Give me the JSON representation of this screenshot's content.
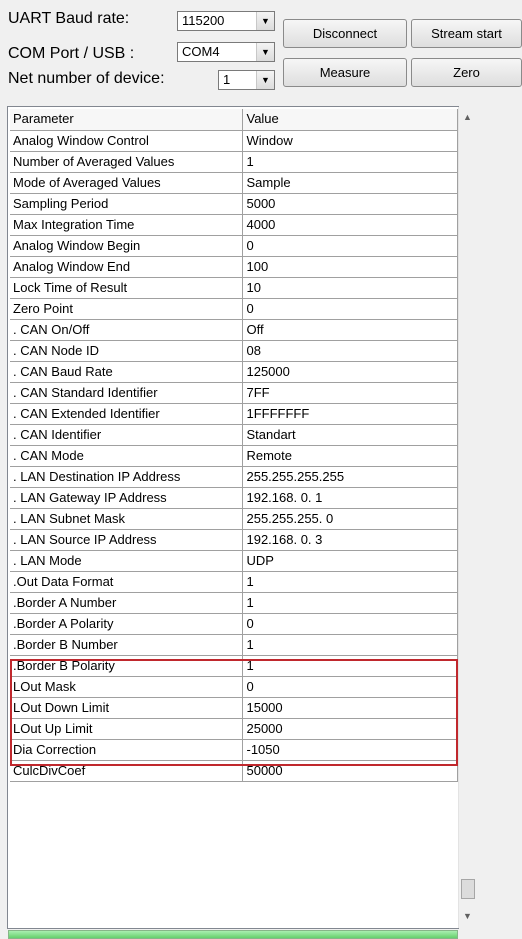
{
  "controls": {
    "baud_label": "UART Baud rate:",
    "baud_value": "115200",
    "port_label": "COM Port / USB :",
    "port_value": "COM4",
    "device_label": "Net number of device:",
    "device_value": "1",
    "disconnect_button": "Disconnect",
    "stream_start_button": "Stream start",
    "measure_button": "Measure",
    "zero_button": "Zero"
  },
  "grid": {
    "headers": [
      "Parameter",
      "Value"
    ],
    "rows": [
      [
        "Analog Window Control",
        "Window"
      ],
      [
        "Number of Averaged Values",
        "1"
      ],
      [
        "Mode of Averaged Values",
        "Sample"
      ],
      [
        "Sampling Period",
        "5000"
      ],
      [
        "Max Integration Time",
        "4000"
      ],
      [
        "Analog Window Begin",
        "0"
      ],
      [
        "Analog Window End",
        "100"
      ],
      [
        "Lock Time of Result",
        "10"
      ],
      [
        "Zero Point",
        "0"
      ],
      [
        ".   CAN On/Off",
        "Off"
      ],
      [
        ".   CAN Node ID",
        "08"
      ],
      [
        ".   CAN Baud Rate",
        "125000"
      ],
      [
        ".   CAN Standard Identifier",
        "7FF"
      ],
      [
        ".   CAN Extended Identifier",
        "1FFFFFFF"
      ],
      [
        ".   CAN Identifier",
        "Standart"
      ],
      [
        ".   CAN Mode",
        "Remote"
      ],
      [
        ". LAN Destination IP Address",
        "255.255.255.255"
      ],
      [
        ". LAN Gateway IP Address",
        "192.168.  0.  1"
      ],
      [
        ". LAN Subnet Mask",
        "255.255.255.  0"
      ],
      [
        ". LAN Source IP Address",
        "192.168.  0.  3"
      ],
      [
        ". LAN Mode",
        "UDP"
      ],
      [
        ".Out Data Format",
        "1"
      ],
      [
        ".Border A Number",
        "1"
      ],
      [
        ".Border A Polarity",
        "0"
      ],
      [
        ".Border B Number",
        "1"
      ],
      [
        ".Border B Polarity",
        "1"
      ],
      [
        "LOut Mask",
        "0"
      ],
      [
        "LOut Down Limit",
        "15000"
      ],
      [
        "LOut Up Limit",
        "25000"
      ],
      [
        "Dia Correction",
        "-1050"
      ],
      [
        "CulcDivCoef",
        "50000"
      ]
    ]
  },
  "colors": {
    "highlight": "#c0282d",
    "status_bar": "#66d06c"
  }
}
